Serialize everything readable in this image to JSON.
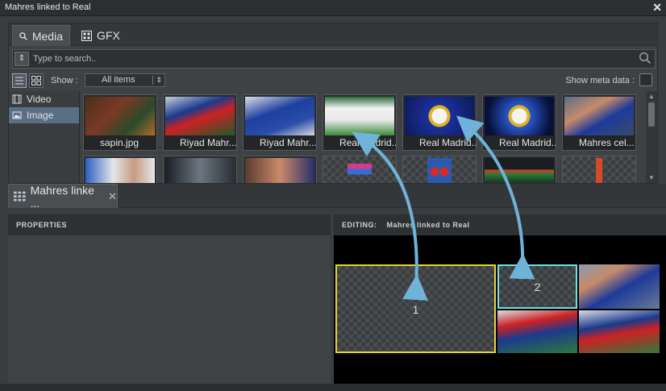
{
  "window": {
    "title": "Mahres linked to Real",
    "close_glyph": "✕"
  },
  "top_tabs": [
    {
      "label": "Media",
      "icon": "search-icon"
    },
    {
      "label": "GFX",
      "icon": "gfx-icon"
    }
  ],
  "search": {
    "placeholder": "Type to search.."
  },
  "filter": {
    "show_label": "Show :",
    "show_value": "All items",
    "meta_label": "Show meta data :"
  },
  "categories": [
    {
      "label": "Video",
      "icon": "film-icon"
    },
    {
      "label": "Image",
      "icon": "image-icon"
    }
  ],
  "media_items": [
    {
      "label": "sapin.jpg"
    },
    {
      "label": "Riyad Mahr..."
    },
    {
      "label": "Riyad Mahr..."
    },
    {
      "label": "Real Madrid..."
    },
    {
      "label": "Real Madrid..."
    },
    {
      "label": "Real Madrid..."
    },
    {
      "label": "Mahres cel..."
    }
  ],
  "doc_tab": {
    "label": "Mahres linke ...",
    "close": "✕"
  },
  "properties": {
    "header": "PROPERTIES"
  },
  "editor": {
    "header_label": "EDITING:",
    "header_name": "Mahres linked to Real"
  },
  "slots": [
    {
      "number": "1"
    },
    {
      "number": "2"
    }
  ],
  "colors": {
    "slot1_border": "#e6d32c",
    "slot2_border": "#6fe0e6",
    "arrow": "#6fb3d9"
  }
}
